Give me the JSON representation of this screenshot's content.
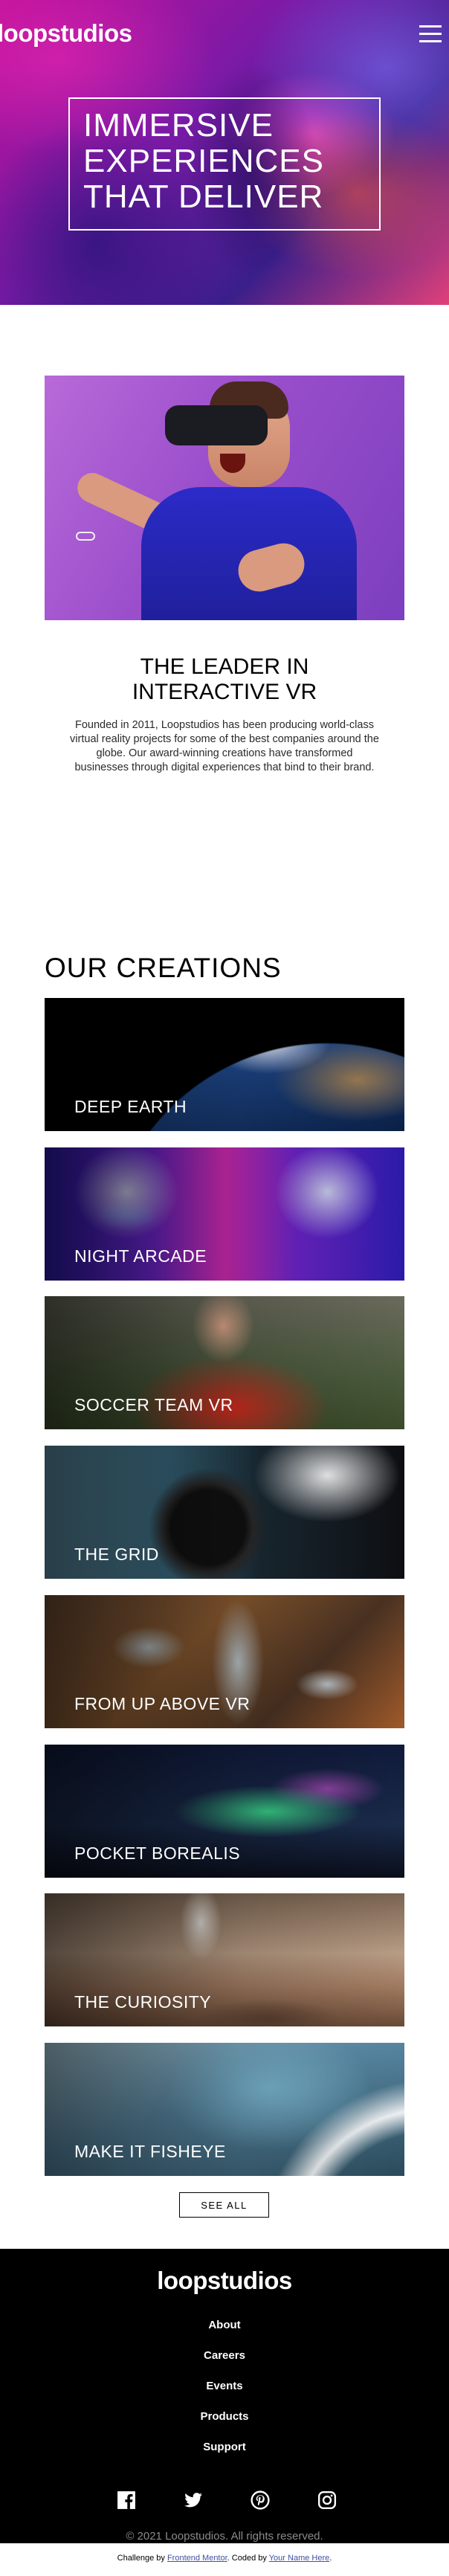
{
  "header": {
    "logo": "loopstudios",
    "menu_icon": "hamburger-menu-icon"
  },
  "hero": {
    "title": "Immersive\nexperiences\nthat deliver"
  },
  "interactive": {
    "title": "The leader in\ninteractive VR",
    "body": "Founded in 2011, Loopstudios has been producing world-class virtual reality projects for some of the best companies around the globe. Our award-winning creations have transformed businesses through digital experiences that bind to their brand."
  },
  "creations": {
    "title": "OUR CREATIONS",
    "items": [
      {
        "label": "Deep earth"
      },
      {
        "label": "Night arcade"
      },
      {
        "label": "Soccer team VR"
      },
      {
        "label": "The grid"
      },
      {
        "label": "From up above VR"
      },
      {
        "label": "Pocket borealis"
      },
      {
        "label": "The curiosity"
      },
      {
        "label": "Make it fisheye"
      }
    ],
    "see_all": "SEE ALL"
  },
  "footer": {
    "logo": "loopstudios",
    "links": [
      "About",
      "Careers",
      "Events",
      "Products",
      "Support"
    ],
    "social": [
      "facebook-icon",
      "twitter-icon",
      "pinterest-icon",
      "instagram-icon"
    ],
    "copyright": "© 2021 Loopstudios. All rights reserved."
  },
  "attribution": {
    "prefix": "Challenge by",
    "frontend_mentor": "Frontend Mentor",
    "middle": ". Coded by",
    "author": "Your Name Here",
    "suffix": "."
  },
  "colors": {
    "footer_bg": "#000000",
    "link_blue": "#3e52a3",
    "copyright_gray": "#8a8a8a"
  }
}
